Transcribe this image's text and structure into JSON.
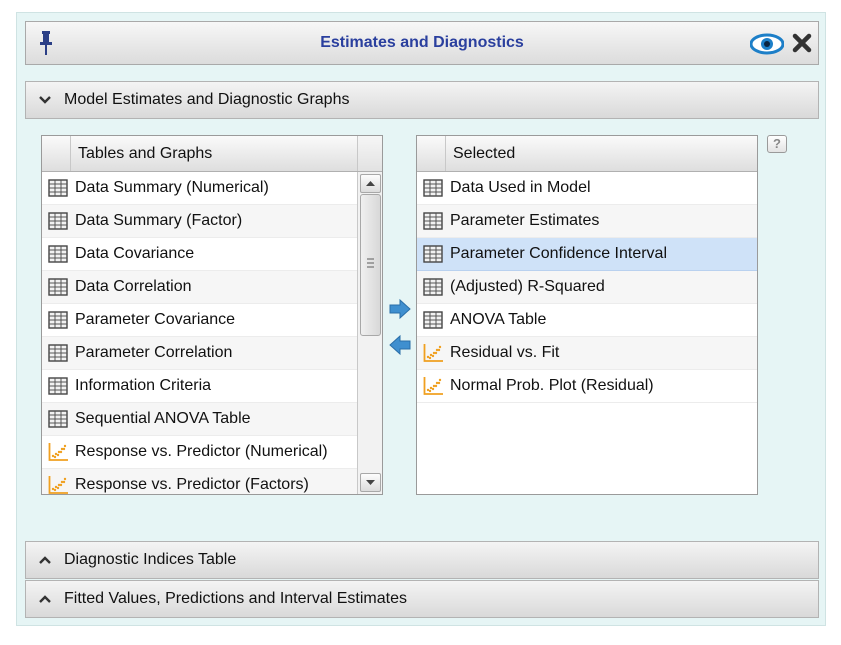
{
  "dialog": {
    "title": "Estimates and Diagnostics",
    "icons": {
      "pin": "pin-icon",
      "eye": "eye-icon",
      "close": "close-icon"
    }
  },
  "sections": [
    {
      "label": "Model Estimates and Diagnostic Graphs",
      "state": "expanded",
      "icon": "chevron-down-icon"
    },
    {
      "label": "Diagnostic Indices Table",
      "state": "collapsed",
      "icon": "chevron-up-icon"
    },
    {
      "label": "Fitted Values, Predictions and Interval Estimates",
      "state": "collapsed",
      "icon": "chevron-up-icon"
    }
  ],
  "available_list": {
    "header": "Tables and Graphs",
    "items": [
      {
        "label": "Data Summary (Numerical)",
        "icon": "table-icon"
      },
      {
        "label": "Data Summary (Factor)",
        "icon": "table-icon"
      },
      {
        "label": "Data Covariance",
        "icon": "table-icon"
      },
      {
        "label": "Data Correlation",
        "icon": "table-icon"
      },
      {
        "label": "Parameter Covariance",
        "icon": "table-icon"
      },
      {
        "label": "Parameter Correlation",
        "icon": "table-icon"
      },
      {
        "label": "Information Criteria",
        "icon": "table-icon"
      },
      {
        "label": "Sequential ANOVA Table",
        "icon": "table-icon"
      },
      {
        "label": "Response vs. Predictor (Numerical)",
        "icon": "scatter-plot-icon"
      },
      {
        "label": "Response vs. Predictor (Factors)",
        "icon": "scatter-plot-icon"
      }
    ]
  },
  "selected_list": {
    "header": "Selected",
    "items": [
      {
        "label": "Data Used in Model",
        "icon": "table-icon"
      },
      {
        "label": "Parameter Estimates",
        "icon": "table-icon"
      },
      {
        "label": "Parameter Confidence Interval",
        "icon": "table-icon",
        "selected": true
      },
      {
        "label": "(Adjusted) R-Squared",
        "icon": "table-icon"
      },
      {
        "label": "ANOVA Table",
        "icon": "table-icon"
      },
      {
        "label": "Residual vs. Fit",
        "icon": "scatter-plot-icon"
      },
      {
        "label": "Normal Prob. Plot (Residual)",
        "icon": "scatter-plot-icon"
      }
    ]
  },
  "controls": {
    "add_icon": "arrow-right-icon",
    "remove_icon": "arrow-left-icon",
    "help_label": "?"
  },
  "colors": {
    "title": "#2a3f9e",
    "panel_bg": "#e6f5f5",
    "selection": "#cfe2f8",
    "arrow": "#3f8fcf",
    "plot_icon": "#f0a020"
  }
}
